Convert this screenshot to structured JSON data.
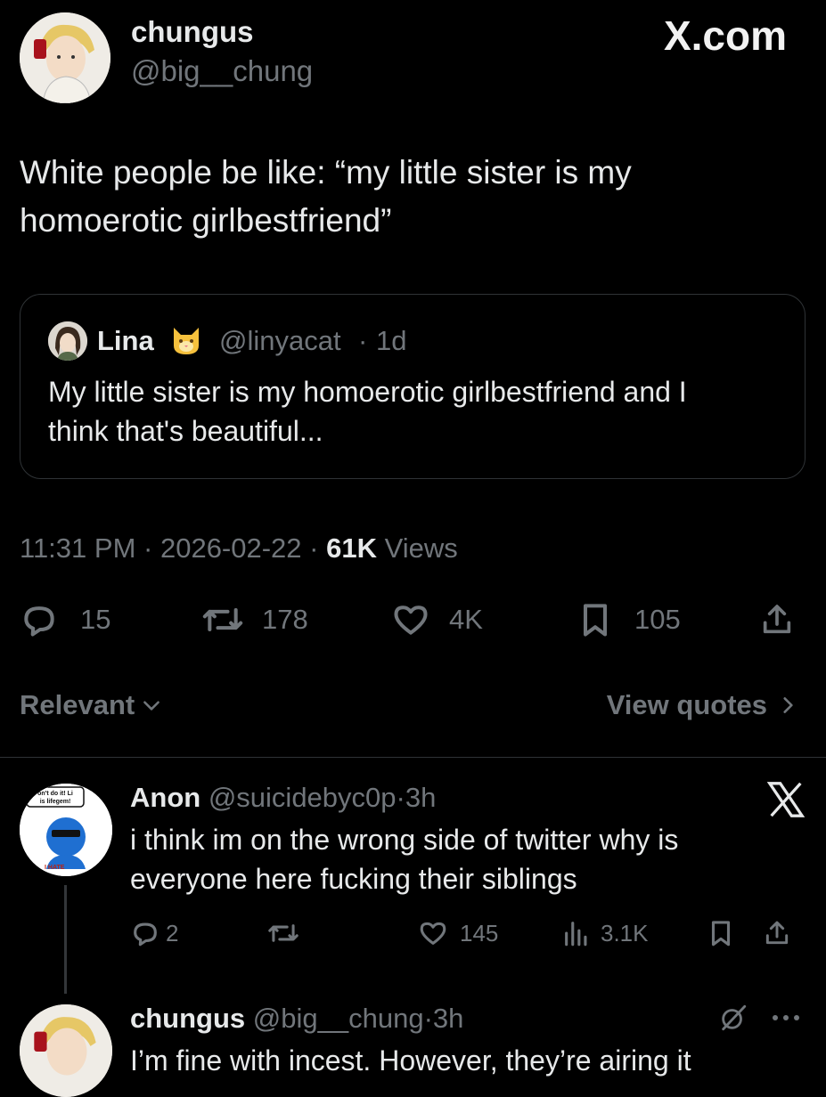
{
  "header": {
    "display_name": "chungus",
    "handle": "@big__chung",
    "brand": "X.com"
  },
  "tweet": {
    "text_line1": "White people be like: “my little sister is my",
    "text_line2": "homoerotic girlbestfriend”"
  },
  "quote": {
    "display_name": "Lina",
    "emoji": "🐱",
    "handle": "@linyacat",
    "time": "1d",
    "text_line1": "My little sister is my homoerotic girlbestfriend and I",
    "text_line2": "think that's beautiful..."
  },
  "meta": {
    "time": "11:31 PM",
    "date": "2026-02-22",
    "views_count": "61K",
    "views_label": "Views",
    "sep": "·"
  },
  "actions": {
    "replies": "15",
    "reposts": "178",
    "likes": "4K",
    "bookmarks": "105"
  },
  "sort": {
    "relevant_label": "Relevant",
    "view_quotes_label": "View quotes"
  },
  "reply1": {
    "display_name": "Anon",
    "handle": "@suicidebyc0p",
    "time": "3h",
    "text_line1": "i think im on the wrong side of twitter why is",
    "text_line2": "everyone here fucking their siblings",
    "avatar_text_top": "on't do it! Li",
    "avatar_text_mid": "is lifegem!",
    "avatar_text_bottom": "I HATE",
    "replies": "2",
    "likes": "145",
    "views": "3.1K"
  },
  "reply2": {
    "display_name": "chungus",
    "handle": "@big__chung",
    "time": "3h",
    "text_line1": "I’m fine with incest. However, they’re airing it"
  },
  "colors": {
    "background": "#000000",
    "text": "#e7e9ea",
    "secondary": "#71767b",
    "border": "#2f3336"
  }
}
